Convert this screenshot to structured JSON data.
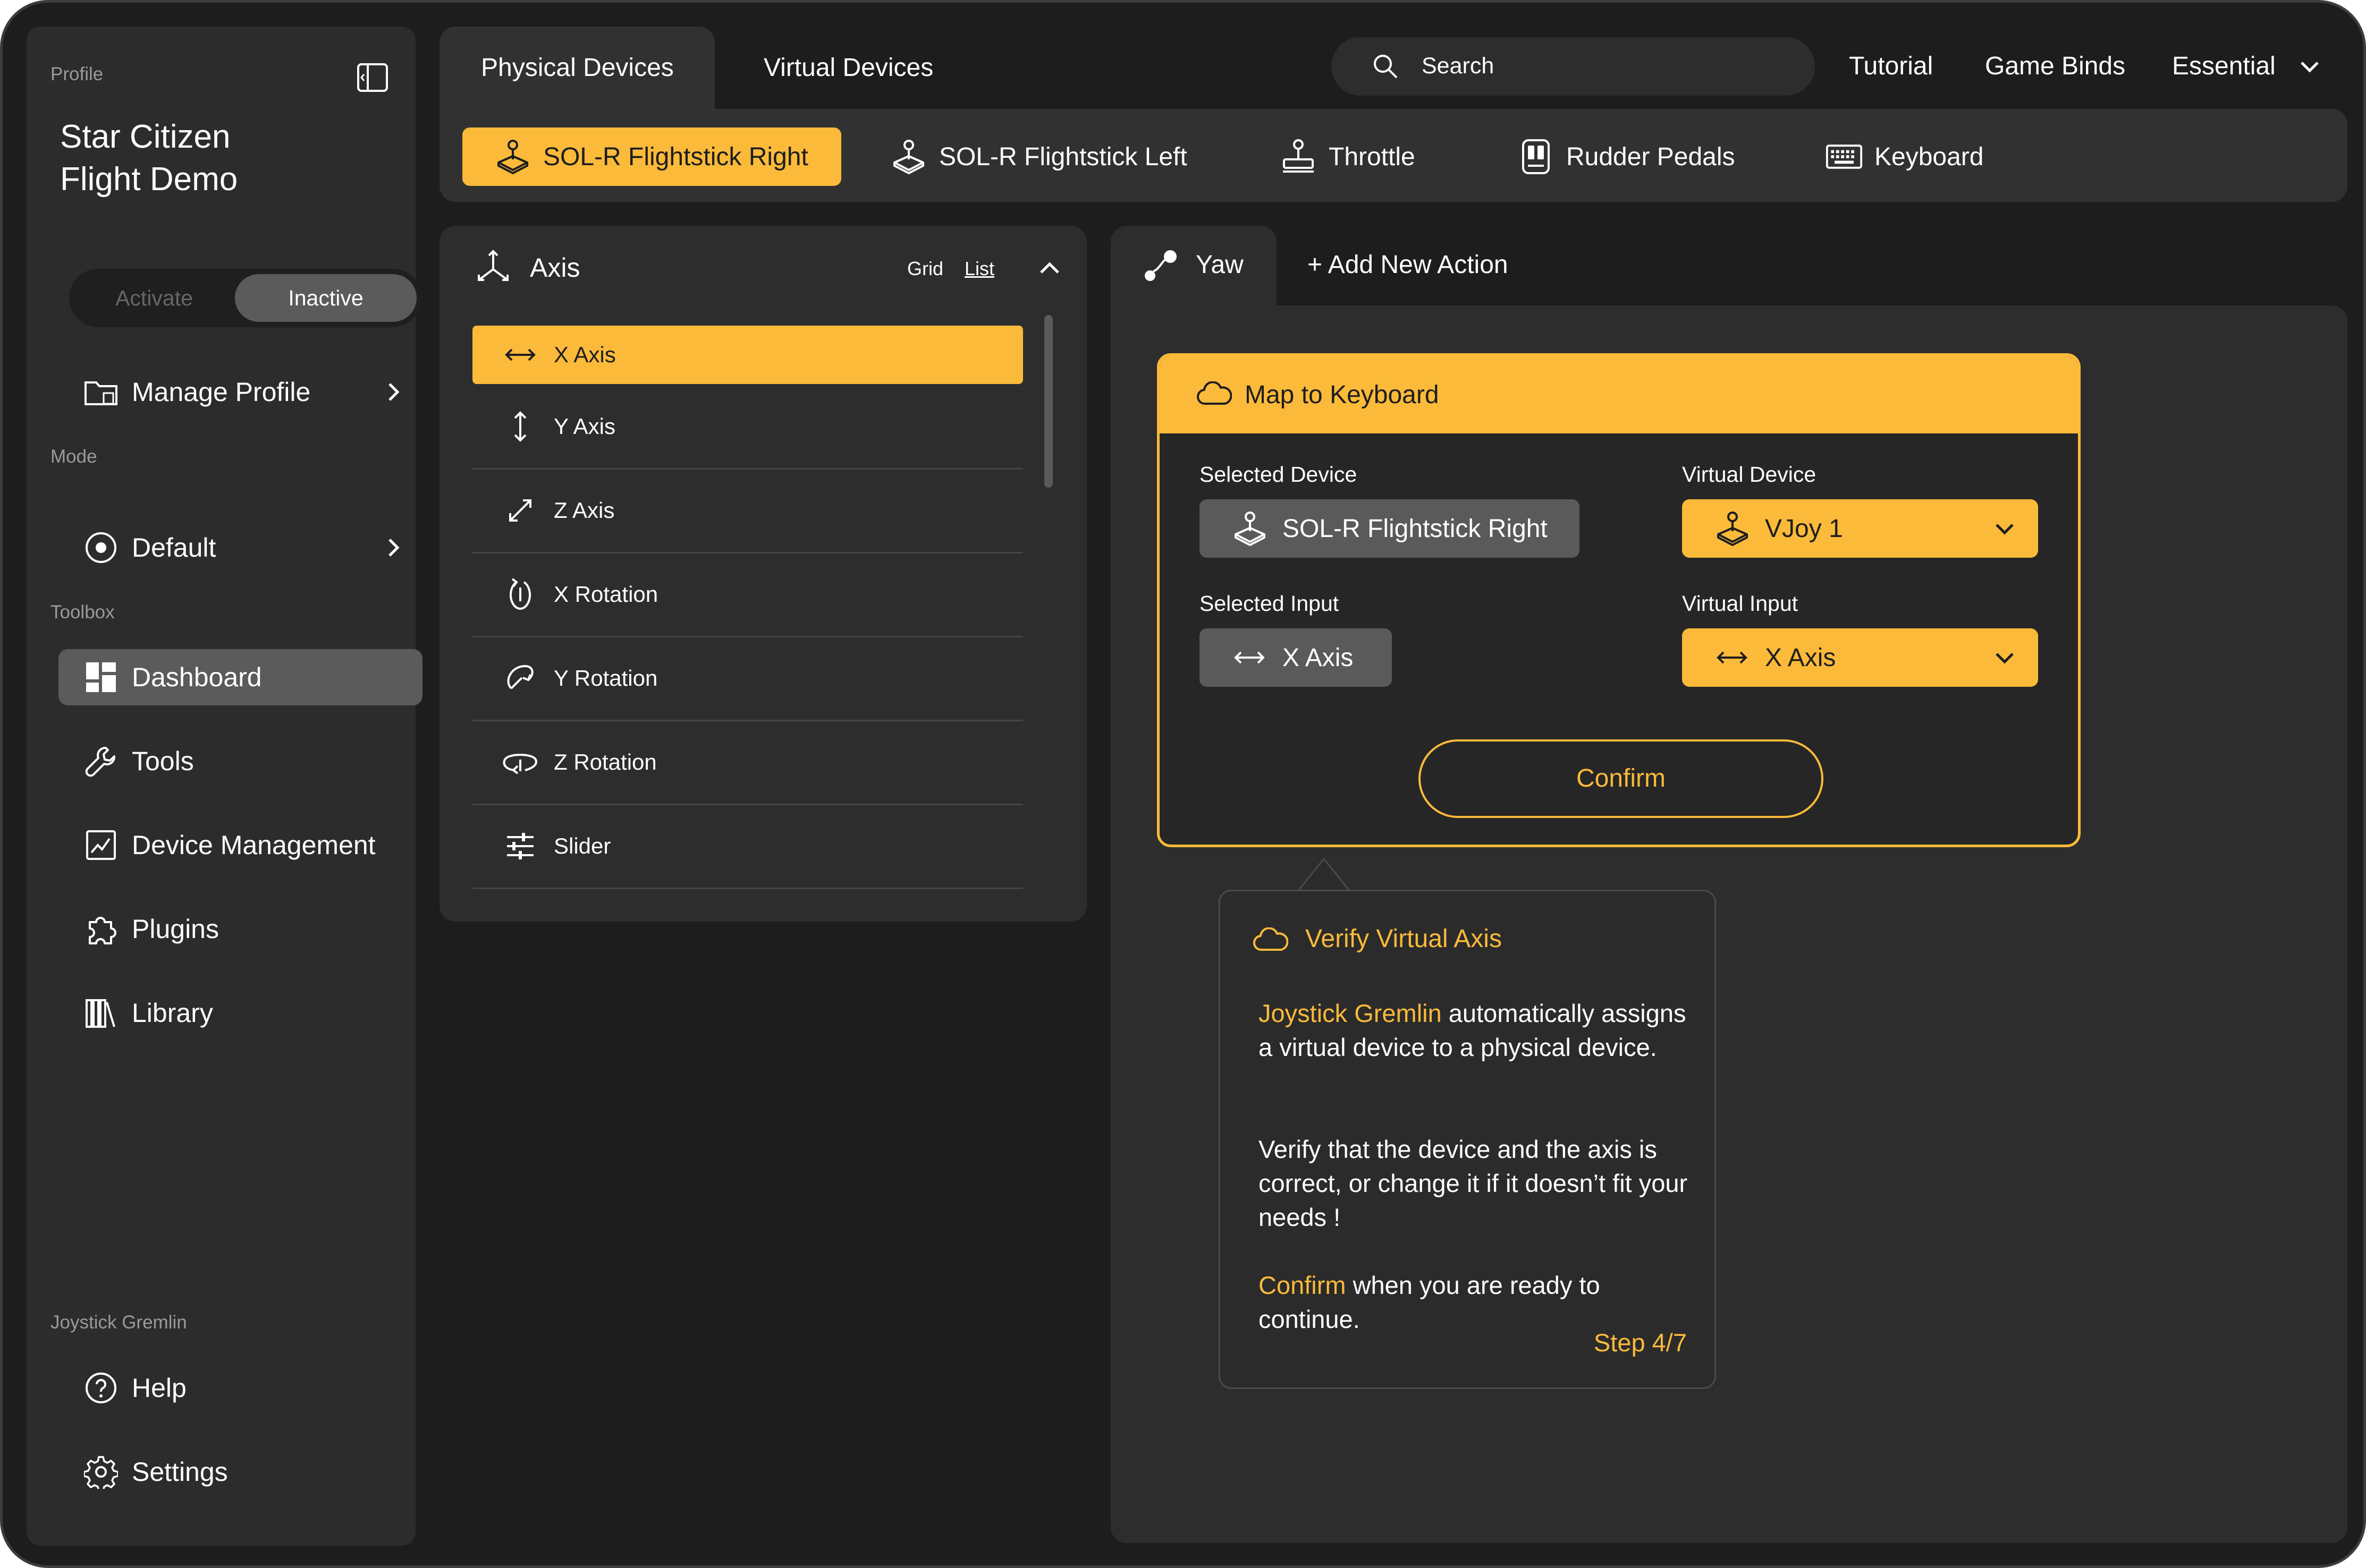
{
  "sidebar": {
    "profile_label": "Profile",
    "profile_title_1": "Star Citizen",
    "profile_title_2": "Flight Demo",
    "toggle": {
      "activate": "Activate",
      "inactive": "Inactive",
      "selected": "Inactive"
    },
    "manage_profile": "Manage Profile",
    "mode_label": "Mode",
    "mode_value": "Default",
    "toolbox_label": "Toolbox",
    "toolbox": [
      {
        "label": "Dashboard",
        "icon": "dashboard-icon",
        "active": true
      },
      {
        "label": "Tools",
        "icon": "wrench-icon"
      },
      {
        "label": "Device Management",
        "icon": "chart-icon"
      },
      {
        "label": "Plugins",
        "icon": "puzzle-icon"
      },
      {
        "label": "Library",
        "icon": "library-icon"
      }
    ],
    "footer_label": "Joystick Gremlin",
    "help": "Help",
    "settings": "Settings"
  },
  "header": {
    "tabs": [
      {
        "label": "Physical Devices",
        "active": true
      },
      {
        "label": "Virtual Devices"
      }
    ],
    "search": {
      "placeholder": "Search"
    },
    "links": {
      "tutorial": "Tutorial",
      "game_binds": "Game Binds",
      "essential": "Essential"
    },
    "devices": [
      {
        "label": "SOL-R Flightstick Right",
        "icon": "joystick-icon",
        "active": true
      },
      {
        "label": "SOL-R Flightstick Left",
        "icon": "joystick-icon"
      },
      {
        "label": "Throttle",
        "icon": "throttle-icon"
      },
      {
        "label": "Rudder Pedals",
        "icon": "pedals-icon"
      },
      {
        "label": "Keyboard",
        "icon": "keyboard-icon"
      }
    ]
  },
  "axis_panel": {
    "title": "Axis",
    "view_grid": "Grid",
    "view_list": "List",
    "items": [
      {
        "label": "X Axis",
        "icon": "horizontal-arrows-icon",
        "active": true
      },
      {
        "label": "Y Axis",
        "icon": "vertical-arrows-icon"
      },
      {
        "label": "Z Axis",
        "icon": "diagonal-arrows-icon"
      },
      {
        "label": "X Rotation",
        "icon": "x-rotation-icon"
      },
      {
        "label": "Y Rotation",
        "icon": "y-rotation-icon"
      },
      {
        "label": "Z Rotation",
        "icon": "z-rotation-icon"
      },
      {
        "label": "Slider",
        "icon": "sliders-icon"
      }
    ]
  },
  "action": {
    "tab": "Yaw",
    "add_new": "+ Add New Action",
    "card": {
      "title": "Map to Keyboard",
      "selected_device_label": "Selected Device",
      "selected_device": "SOL-R Flightstick Right",
      "virtual_device_label": "Virtual Device",
      "virtual_device": "VJoy 1",
      "selected_input_label": "Selected Input",
      "selected_input": "X Axis",
      "virtual_input_label": "Virtual Input",
      "virtual_input": "X Axis",
      "confirm": "Confirm"
    }
  },
  "tooltip": {
    "title": "Verify Virtual Axis",
    "p1_highlight": "Joystick Gremlin",
    "p1_rest": " automatically assigns a virtual device to a physical device.",
    "p2": "Verify that the device and the axis is correct, or change it if it doesn’t fit your needs !",
    "p3_highlight": "Confirm",
    "p3_rest": " when you are ready to continue.",
    "step": "Step 4/7"
  },
  "colors": {
    "accent": "#fbba3a",
    "panel": "#2d2d2d",
    "background": "#1d1d1d"
  }
}
